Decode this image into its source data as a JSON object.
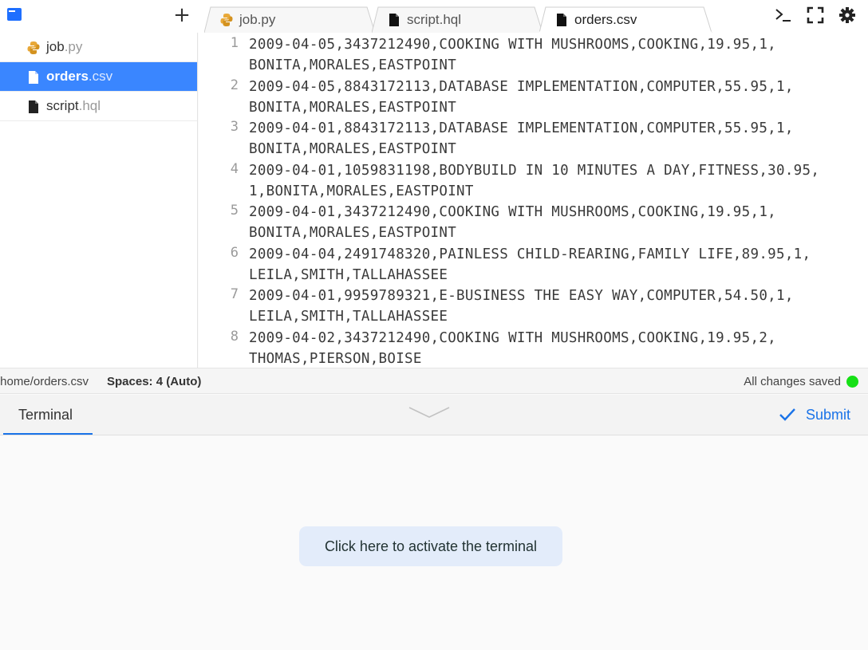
{
  "tabs": [
    {
      "label": "job.py",
      "icon": "python-icon"
    },
    {
      "label": "script.hql",
      "icon": "file-icon"
    },
    {
      "label": "orders.csv",
      "icon": "file-icon",
      "active": true
    }
  ],
  "sidebar": {
    "add_label": "+",
    "files": [
      {
        "name": "job",
        "ext": ".py",
        "icon": "python-icon"
      },
      {
        "name": "orders",
        "ext": ".csv",
        "icon": "file-icon",
        "active": true
      },
      {
        "name": "script",
        "ext": ".hql",
        "icon": "file-icon"
      }
    ]
  },
  "editor": {
    "lines": [
      {
        "n": "1",
        "text": "2009-04-05,3437212490,COOKING WITH MUSHROOMS,COOKING,19.95,1,\nBONITA,MORALES,EASTPOINT"
      },
      {
        "n": "2",
        "text": "2009-04-05,8843172113,DATABASE IMPLEMENTATION,COMPUTER,55.95,1,\nBONITA,MORALES,EASTPOINT"
      },
      {
        "n": "3",
        "text": "2009-04-01,8843172113,DATABASE IMPLEMENTATION,COMPUTER,55.95,1,\nBONITA,MORALES,EASTPOINT"
      },
      {
        "n": "4",
        "text": "2009-04-01,1059831198,BODYBUILD IN 10 MINUTES A DAY,FITNESS,30.95,\n1,BONITA,MORALES,EASTPOINT"
      },
      {
        "n": "5",
        "text": "2009-04-01,3437212490,COOKING WITH MUSHROOMS,COOKING,19.95,1,\nBONITA,MORALES,EASTPOINT"
      },
      {
        "n": "6",
        "text": "2009-04-04,2491748320,PAINLESS CHILD-REARING,FAMILY LIFE,89.95,1,\nLEILA,SMITH,TALLAHASSEE"
      },
      {
        "n": "7",
        "text": "2009-04-01,9959789321,E-BUSINESS THE EASY WAY,COMPUTER,54.50,1,\nLEILA,SMITH,TALLAHASSEE"
      },
      {
        "n": "8",
        "text": "2009-04-02,3437212490,COOKING WITH MUSHROOMS,COOKING,19.95,2,\nTHOMAS,PIERSON,BOISE"
      }
    ]
  },
  "status": {
    "path": "/home/orders.csv",
    "spaces": "Spaces: 4 (Auto)",
    "saved": "All changes saved",
    "saved_color": "#16e016"
  },
  "panel": {
    "terminal_tab": "Terminal",
    "submit_label": "Submit",
    "activate_label": "Click here to activate the terminal"
  },
  "colors": {
    "accent": "#1a73e8",
    "active_file_bg": "#3a86ff",
    "python_icon": "#e8a838"
  }
}
